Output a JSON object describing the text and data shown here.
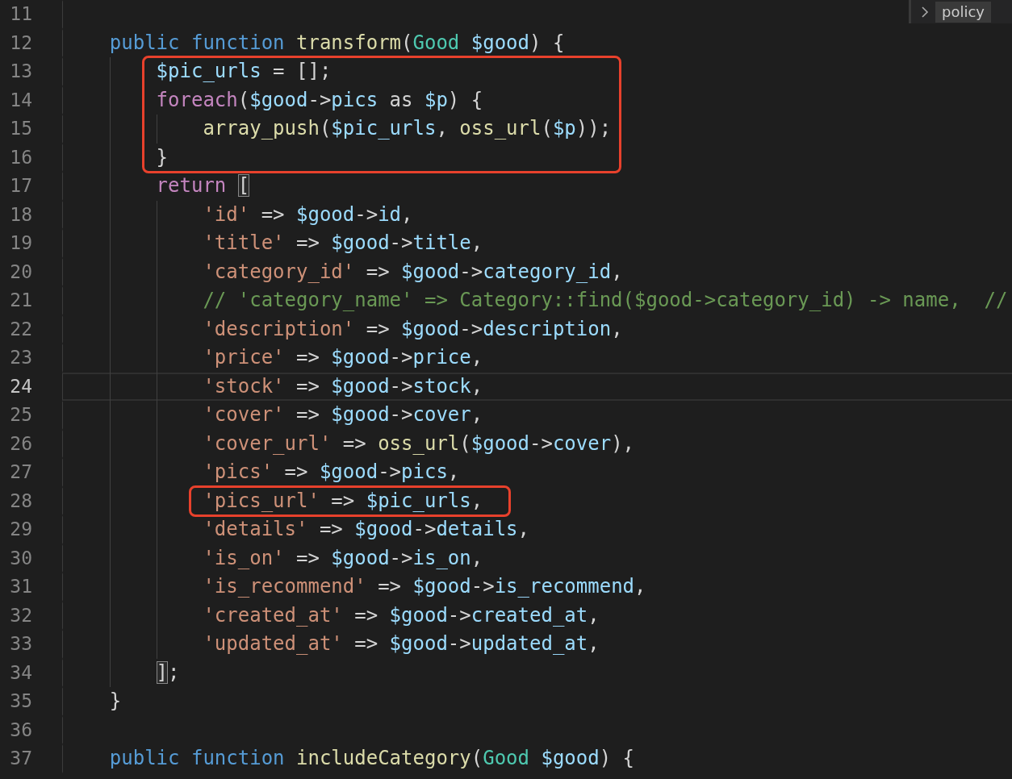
{
  "popup": {
    "label": "policy"
  },
  "lines": [
    {
      "number": "11",
      "current": false,
      "boxed": false
    },
    {
      "number": "12",
      "current": false,
      "boxed": false,
      "tokens": [
        {
          "kind": "kw",
          "text": "    public"
        },
        {
          "kind": "kw",
          "text": " function"
        },
        {
          "kind": "fn",
          "text": " transform"
        },
        {
          "kind": "op",
          "text": "("
        },
        {
          "kind": "type",
          "text": "Good"
        },
        {
          "kind": "var",
          "text": " $good"
        },
        {
          "kind": "op",
          "text": ") {"
        }
      ]
    },
    {
      "number": "13",
      "current": false,
      "boxed": true,
      "tokens": [
        {
          "kind": "var",
          "text": "        $pic_urls"
        },
        {
          "kind": "op",
          "text": " = [];"
        }
      ]
    },
    {
      "number": "14",
      "current": false,
      "boxed": true,
      "tokens": [
        {
          "kind": "ctl",
          "text": "        foreach"
        },
        {
          "kind": "op",
          "text": "("
        },
        {
          "kind": "var",
          "text": "$good"
        },
        {
          "kind": "op",
          "text": "->"
        },
        {
          "kind": "var",
          "text": "pics"
        },
        {
          "kind": "op",
          "text": " as "
        },
        {
          "kind": "var",
          "text": "$p"
        },
        {
          "kind": "op",
          "text": ") {"
        }
      ]
    },
    {
      "number": "15",
      "current": false,
      "boxed": true,
      "tokens": [
        {
          "kind": "fn",
          "text": "            array_push"
        },
        {
          "kind": "op",
          "text": "("
        },
        {
          "kind": "var",
          "text": "$pic_urls"
        },
        {
          "kind": "op",
          "text": ", "
        },
        {
          "kind": "fn",
          "text": "oss_url"
        },
        {
          "kind": "op",
          "text": "("
        },
        {
          "kind": "var",
          "text": "$p"
        },
        {
          "kind": "op",
          "text": "));"
        }
      ]
    },
    {
      "number": "16",
      "current": false,
      "boxed": true,
      "tokens": [
        {
          "kind": "op",
          "text": "        }"
        }
      ]
    },
    {
      "number": "17",
      "current": false,
      "boxed": false,
      "tokens": [
        {
          "kind": "ctl",
          "text": "        return"
        },
        {
          "kind": "match",
          "text": " ["
        }
      ]
    },
    {
      "number": "18",
      "current": false,
      "boxed": false,
      "tokens": [
        {
          "kind": "str",
          "text": "            'id'"
        },
        {
          "kind": "op",
          "text": " => "
        },
        {
          "kind": "var",
          "text": "$good"
        },
        {
          "kind": "op",
          "text": "->"
        },
        {
          "kind": "var",
          "text": "id"
        },
        {
          "kind": "op",
          "text": ","
        }
      ]
    },
    {
      "number": "19",
      "current": false,
      "boxed": false,
      "tokens": [
        {
          "kind": "str",
          "text": "            'title'"
        },
        {
          "kind": "op",
          "text": " => "
        },
        {
          "kind": "var",
          "text": "$good"
        },
        {
          "kind": "op",
          "text": "->"
        },
        {
          "kind": "var",
          "text": "title"
        },
        {
          "kind": "op",
          "text": ","
        }
      ]
    },
    {
      "number": "20",
      "current": false,
      "boxed": false,
      "tokens": [
        {
          "kind": "str",
          "text": "            'category_id'"
        },
        {
          "kind": "op",
          "text": " => "
        },
        {
          "kind": "var",
          "text": "$good"
        },
        {
          "kind": "op",
          "text": "->"
        },
        {
          "kind": "var",
          "text": "category_id"
        },
        {
          "kind": "op",
          "text": ","
        }
      ]
    },
    {
      "number": "21",
      "current": false,
      "boxed": false,
      "tokens": [
        {
          "kind": "cmt",
          "text": "            // 'category_name' => Category::find($good->category_id) -> name,  //"
        }
      ]
    },
    {
      "number": "22",
      "current": false,
      "boxed": false,
      "tokens": [
        {
          "kind": "str",
          "text": "            'description'"
        },
        {
          "kind": "op",
          "text": " => "
        },
        {
          "kind": "var",
          "text": "$good"
        },
        {
          "kind": "op",
          "text": "->"
        },
        {
          "kind": "var",
          "text": "description"
        },
        {
          "kind": "op",
          "text": ","
        }
      ]
    },
    {
      "number": "23",
      "current": false,
      "boxed": false,
      "tokens": [
        {
          "kind": "str",
          "text": "            'price'"
        },
        {
          "kind": "op",
          "text": " => "
        },
        {
          "kind": "var",
          "text": "$good"
        },
        {
          "kind": "op",
          "text": "->"
        },
        {
          "kind": "var",
          "text": "price"
        },
        {
          "kind": "op",
          "text": ","
        }
      ]
    },
    {
      "number": "24",
      "current": true,
      "boxed": false,
      "tokens": [
        {
          "kind": "str",
          "text": "            'stock'"
        },
        {
          "kind": "op",
          "text": " => "
        },
        {
          "kind": "var",
          "text": "$good"
        },
        {
          "kind": "op",
          "text": "->"
        },
        {
          "kind": "var",
          "text": "stock"
        },
        {
          "kind": "op",
          "text": ","
        }
      ]
    },
    {
      "number": "25",
      "current": false,
      "boxed": false,
      "tokens": [
        {
          "kind": "str",
          "text": "            'cover'"
        },
        {
          "kind": "op",
          "text": " => "
        },
        {
          "kind": "var",
          "text": "$good"
        },
        {
          "kind": "op",
          "text": "->"
        },
        {
          "kind": "var",
          "text": "cover"
        },
        {
          "kind": "op",
          "text": ","
        }
      ]
    },
    {
      "number": "26",
      "current": false,
      "boxed": false,
      "tokens": [
        {
          "kind": "str",
          "text": "            'cover_url'"
        },
        {
          "kind": "op",
          "text": " => "
        },
        {
          "kind": "fn",
          "text": "oss_url"
        },
        {
          "kind": "op",
          "text": "("
        },
        {
          "kind": "var",
          "text": "$good"
        },
        {
          "kind": "op",
          "text": "->"
        },
        {
          "kind": "var",
          "text": "cover"
        },
        {
          "kind": "op",
          "text": "),"
        }
      ]
    },
    {
      "number": "27",
      "current": false,
      "boxed": false,
      "tokens": [
        {
          "kind": "str",
          "text": "            'pics'"
        },
        {
          "kind": "op",
          "text": " => "
        },
        {
          "kind": "var",
          "text": "$good"
        },
        {
          "kind": "op",
          "text": "->"
        },
        {
          "kind": "var",
          "text": "pics"
        },
        {
          "kind": "op",
          "text": ","
        }
      ]
    },
    {
      "number": "28",
      "current": false,
      "boxed": true,
      "tokens": [
        {
          "kind": "str",
          "text": "            'pics_url'"
        },
        {
          "kind": "op",
          "text": " => "
        },
        {
          "kind": "var",
          "text": "$pic_urls"
        },
        {
          "kind": "op",
          "text": ","
        }
      ]
    },
    {
      "number": "29",
      "current": false,
      "boxed": false,
      "tokens": [
        {
          "kind": "str",
          "text": "            'details'"
        },
        {
          "kind": "op",
          "text": " => "
        },
        {
          "kind": "var",
          "text": "$good"
        },
        {
          "kind": "op",
          "text": "->"
        },
        {
          "kind": "var",
          "text": "details"
        },
        {
          "kind": "op",
          "text": ","
        }
      ]
    },
    {
      "number": "30",
      "current": false,
      "boxed": false,
      "tokens": [
        {
          "kind": "str",
          "text": "            'is_on'"
        },
        {
          "kind": "op",
          "text": " => "
        },
        {
          "kind": "var",
          "text": "$good"
        },
        {
          "kind": "op",
          "text": "->"
        },
        {
          "kind": "var",
          "text": "is_on"
        },
        {
          "kind": "op",
          "text": ","
        }
      ]
    },
    {
      "number": "31",
      "current": false,
      "boxed": false,
      "tokens": [
        {
          "kind": "str",
          "text": "            'is_recommend'"
        },
        {
          "kind": "op",
          "text": " => "
        },
        {
          "kind": "var",
          "text": "$good"
        },
        {
          "kind": "op",
          "text": "->"
        },
        {
          "kind": "var",
          "text": "is_recommend"
        },
        {
          "kind": "op",
          "text": ","
        }
      ]
    },
    {
      "number": "32",
      "current": false,
      "boxed": false,
      "tokens": [
        {
          "kind": "str",
          "text": "            'created_at'"
        },
        {
          "kind": "op",
          "text": " => "
        },
        {
          "kind": "var",
          "text": "$good"
        },
        {
          "kind": "op",
          "text": "->"
        },
        {
          "kind": "var",
          "text": "created_at"
        },
        {
          "kind": "op",
          "text": ","
        }
      ]
    },
    {
      "number": "33",
      "current": false,
      "boxed": false,
      "tokens": [
        {
          "kind": "str",
          "text": "            'updated_at'"
        },
        {
          "kind": "op",
          "text": " => "
        },
        {
          "kind": "var",
          "text": "$good"
        },
        {
          "kind": "op",
          "text": "->"
        },
        {
          "kind": "var",
          "text": "updated_at"
        },
        {
          "kind": "op",
          "text": ","
        }
      ]
    },
    {
      "number": "34",
      "current": false,
      "boxed": false,
      "tokens": [
        {
          "kind": "match",
          "text": "        ]"
        },
        {
          "kind": "op",
          "text": ";"
        }
      ]
    },
    {
      "number": "35",
      "current": false,
      "boxed": false,
      "tokens": [
        {
          "kind": "op",
          "text": "    }"
        }
      ]
    },
    {
      "number": "36",
      "current": false,
      "boxed": false
    },
    {
      "number": "37",
      "current": false,
      "boxed": false,
      "tokens": [
        {
          "kind": "kw",
          "text": "    public"
        },
        {
          "kind": "kw",
          "text": " function"
        },
        {
          "kind": "fn",
          "text": " includeCategory"
        },
        {
          "kind": "op",
          "text": "("
        },
        {
          "kind": "type",
          "text": "Good"
        },
        {
          "kind": "var",
          "text": " $good"
        },
        {
          "kind": "op",
          "text": ") {"
        }
      ]
    }
  ]
}
